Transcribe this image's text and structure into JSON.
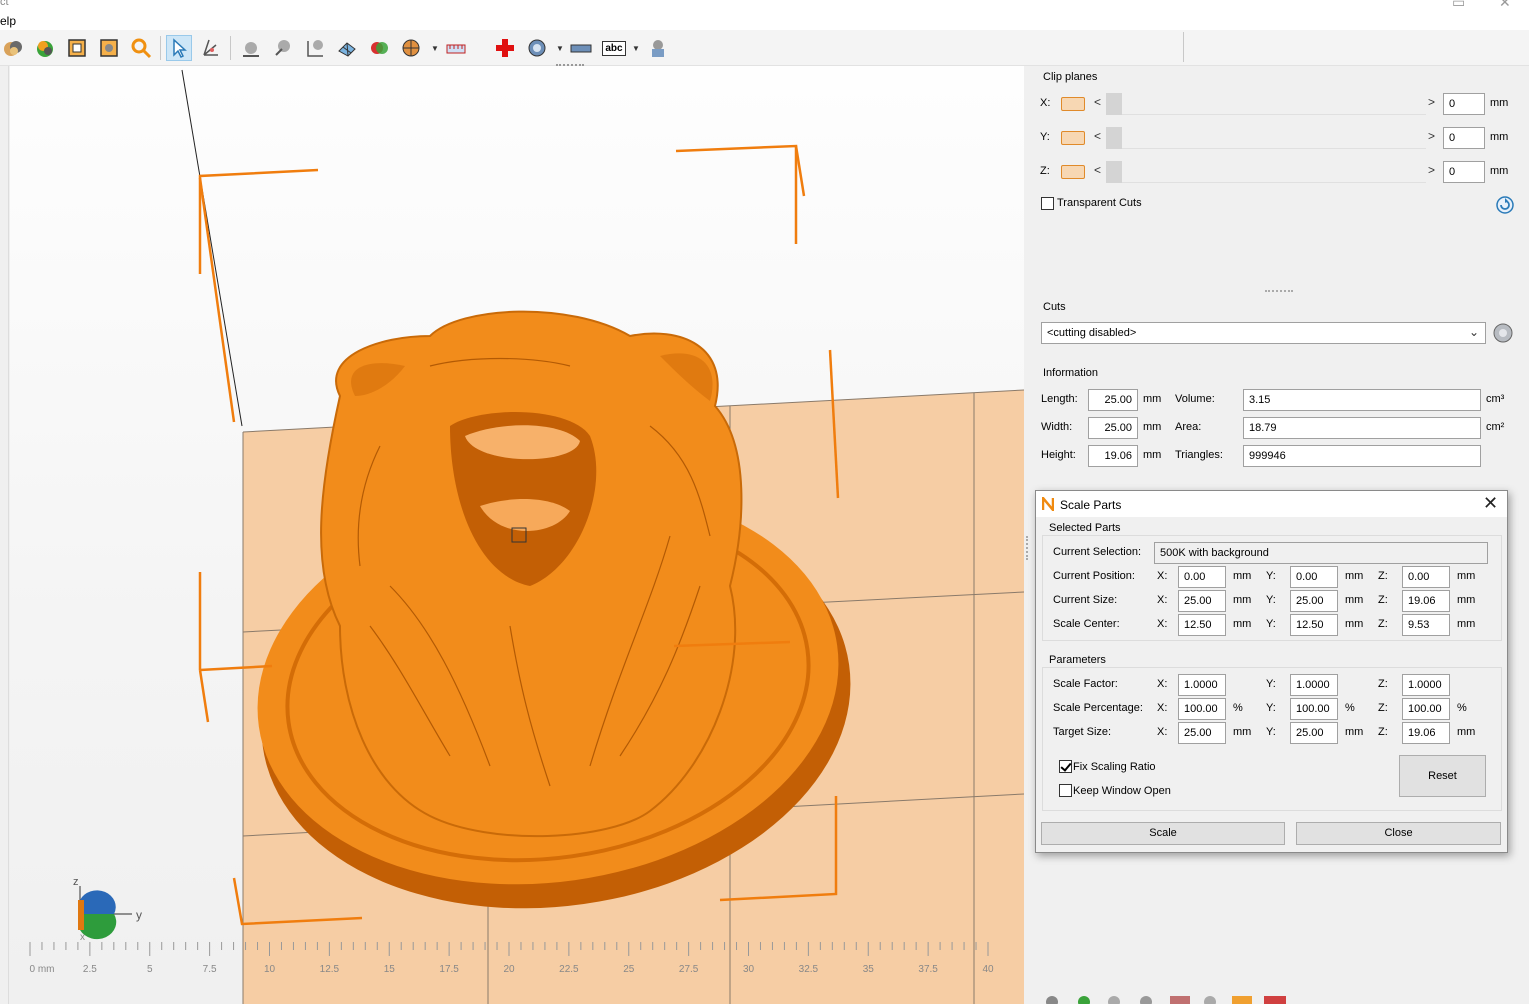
{
  "window": {
    "title_fragment": "ct",
    "menu_fragment": "elp"
  },
  "toolbar": {
    "icons": [
      "open-icon",
      "sphere-color-icon",
      "wire-box-icon",
      "box-view-icon",
      "zoom-icon",
      "select-arrow-icon",
      "move-axes-icon",
      "sphere-drop-icon",
      "sphere-arrow-icon",
      "sphere-tree-icon",
      "mesh-icon",
      "red-green-sphere-icon",
      "pie-icon",
      "ruler-red-icon",
      "red-cross-icon",
      "dial-icon",
      "measure-bar-icon",
      "text-abc-icon",
      "stamp-icon"
    ],
    "abc_label": "abc"
  },
  "ruler": {
    "labels": [
      "0 mm",
      "2.5",
      "5",
      "7.5",
      "10",
      "12.5",
      "15",
      "17.5",
      "20",
      "22.5",
      "25",
      "27.5",
      "30",
      "32.5",
      "35",
      "37.5",
      "40"
    ]
  },
  "axes": {
    "z": "z",
    "y": "y",
    "x": "x"
  },
  "clip": {
    "title": "Clip planes",
    "rows": [
      {
        "axis": "X:",
        "value": "0",
        "unit": "mm"
      },
      {
        "axis": "Y:",
        "value": "0",
        "unit": "mm"
      },
      {
        "axis": "Z:",
        "value": "0",
        "unit": "mm"
      }
    ],
    "transparent_cuts": "Transparent Cuts",
    "arrow_left": "<",
    "arrow_right": ">"
  },
  "cuts": {
    "title": "Cuts",
    "selected": "<cutting disabled>"
  },
  "info": {
    "title": "Information",
    "length_label": "Length:",
    "length": "25.00",
    "width_label": "Width:",
    "width": "25.00",
    "height_label": "Height:",
    "height": "19.06",
    "mm": "mm",
    "volume_label": "Volume:",
    "volume": "3.15",
    "volume_unit": "cm³",
    "area_label": "Area:",
    "area": "18.79",
    "area_unit": "cm²",
    "triangles_label": "Triangles:",
    "triangles": "999946"
  },
  "dialog": {
    "title": "Scale Parts",
    "close": "✕",
    "selected_parts": "Selected Parts",
    "current_selection_label": "Current Selection:",
    "current_selection": "500K with background",
    "x": "X:",
    "y": "Y:",
    "z": "Z:",
    "mm": "mm",
    "pct": "%",
    "rows": [
      {
        "label": "Current Position:",
        "x": "0.00",
        "y": "0.00",
        "z": "0.00",
        "unit": "mm"
      },
      {
        "label": "Current Size:",
        "x": "25.00",
        "y": "25.00",
        "z": "19.06",
        "unit": "mm"
      },
      {
        "label": "Scale Center:",
        "x": "12.50",
        "y": "12.50",
        "z": "9.53",
        "unit": "mm"
      }
    ],
    "parameters": "Parameters",
    "prows": [
      {
        "label": "Scale Factor:",
        "x": "1.0000",
        "y": "1.0000",
        "z": "1.0000",
        "unit": ""
      },
      {
        "label": "Scale Percentage:",
        "x": "100.00",
        "y": "100.00",
        "z": "100.00",
        "unit": "%"
      },
      {
        "label": "Target Size:",
        "x": "25.00",
        "y": "25.00",
        "z": "19.06",
        "unit": "mm"
      }
    ],
    "fix_ratio": "Fix Scaling Ratio",
    "fix_ratio_checked": true,
    "keep_open": "Keep Window Open",
    "keep_open_checked": false,
    "reset": "Reset",
    "scale": "Scale",
    "close_btn": "Close"
  },
  "colors": {
    "model": "#f28c1b",
    "platform": "#f6cda4",
    "bbox": "#f07d0e",
    "accent": "#0078d7"
  }
}
